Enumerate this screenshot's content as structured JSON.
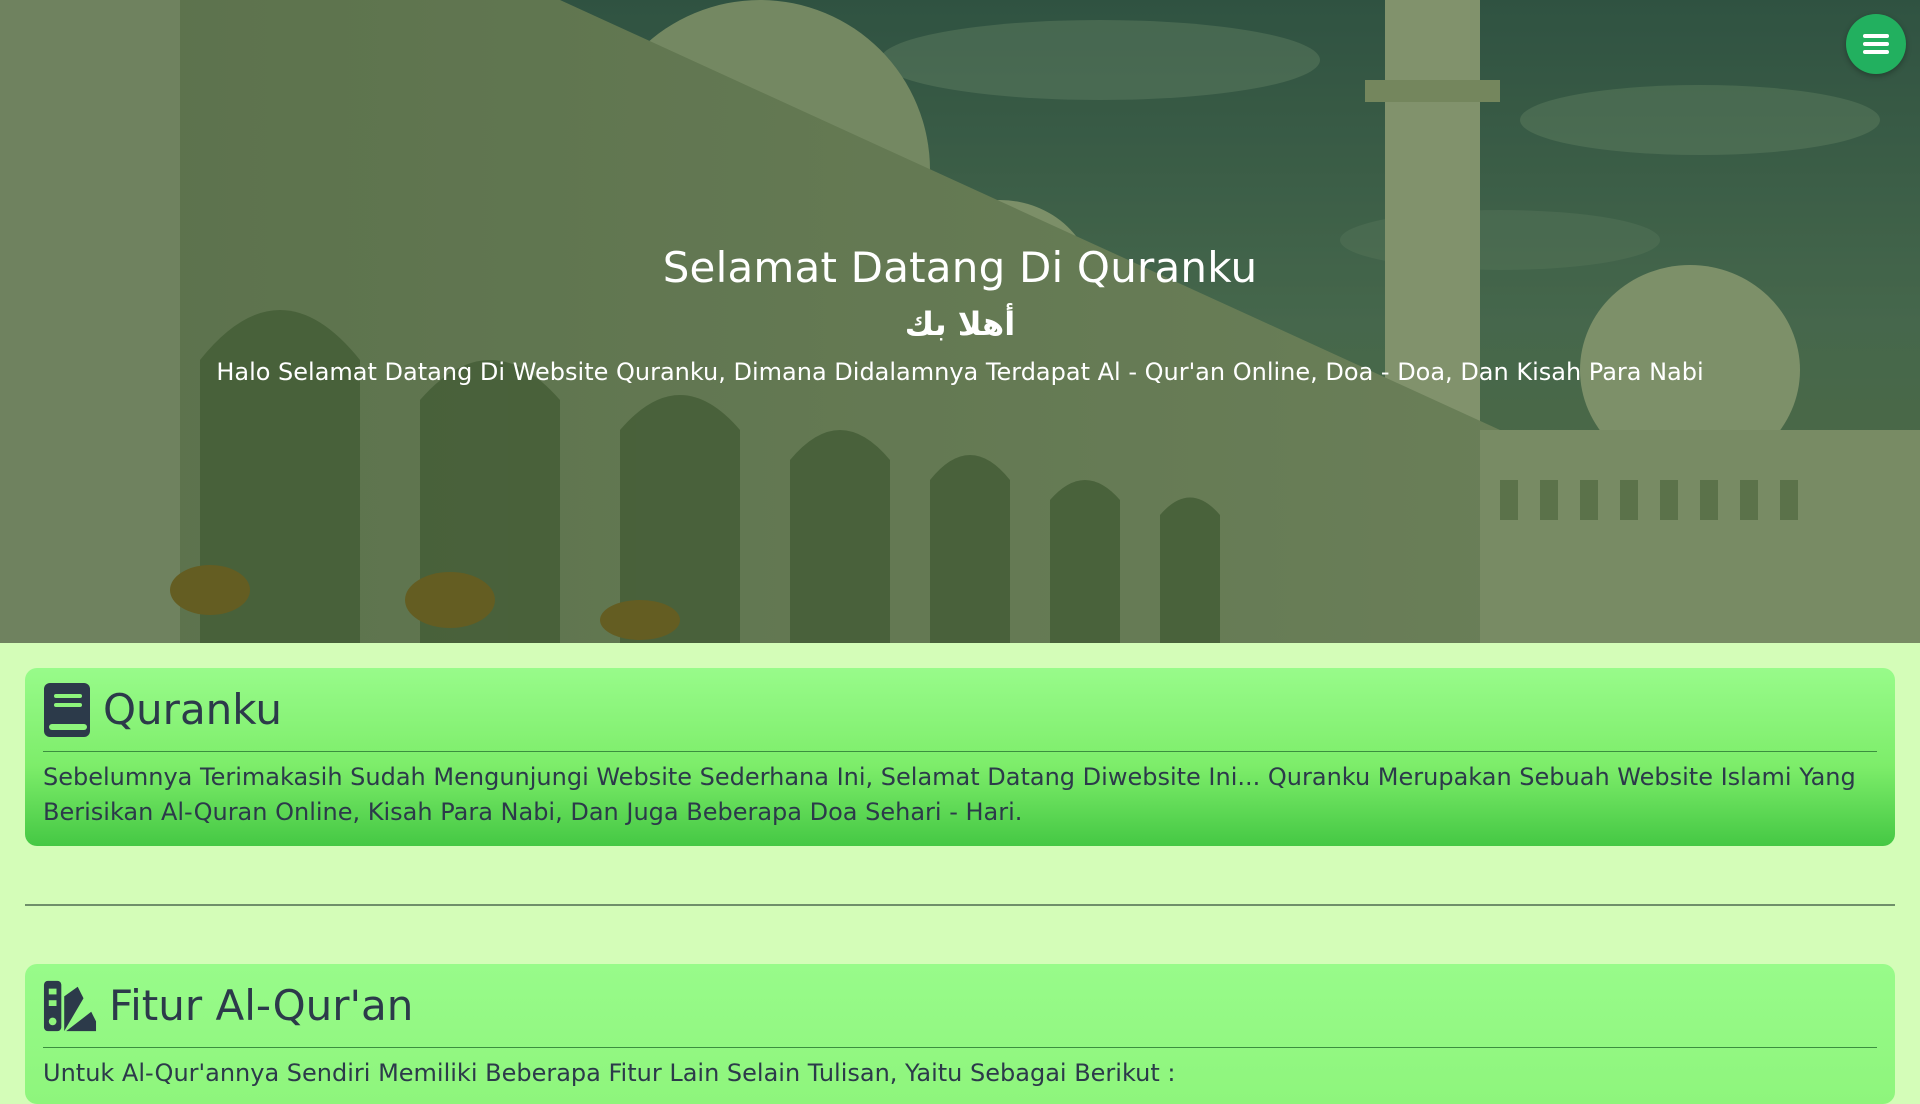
{
  "hero": {
    "title": "Selamat Datang Di Quranku",
    "arabic": "أهلا بك",
    "subtitle": "Halo Selamat Datang Di Website Quranku, Dimana Didalamnya Terdapat Al - Qur'an Online, Doa - Doa, Dan Kisah Para Nabi"
  },
  "menu": {
    "icon": "hamburger-menu-icon",
    "color": "#22b05f"
  },
  "cards": [
    {
      "icon": "book-icon",
      "title": "Quranku",
      "body": "Sebelumnya Terimakasih Sudah Mengunjungi Website Sederhana Ini, Selamat Datang Diwebsite Ini... Quranku Merupakan Sebuah Website Islami Yang Berisikan Al-Quran Online, Kisah Para Nabi, Dan Juga Beberapa Doa Sehari - Hari."
    },
    {
      "icon": "swatchbook-icon",
      "title": "Fitur Al-Qur'an",
      "body": "Untuk Al-Qur'annya Sendiri Memiliki Beberapa Fitur Lain Selain Tulisan, Yaitu Sebagai Berikut :"
    }
  ],
  "colors": {
    "page_background": "#d4fdb8",
    "card_gradient_top": "#98fb8a",
    "card_gradient_bottom": "#45c844",
    "text": "#2c3a4a"
  }
}
